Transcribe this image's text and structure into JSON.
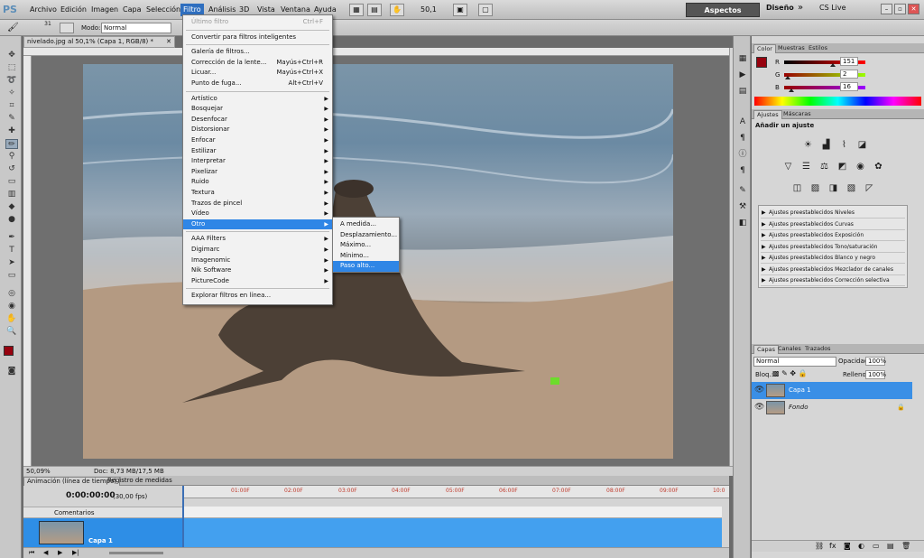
{
  "menubar": {
    "logo": "PS",
    "items": [
      "Archivo",
      "Edición",
      "Imagen",
      "Capa",
      "Selección",
      "Filtro",
      "Análisis",
      "3D",
      "Vista",
      "Ventana",
      "Ayuda"
    ],
    "zoom": "50,1",
    "workspace": "Aspectos esenciales",
    "design": "Diseño",
    "more": "»",
    "cslive": "CS Live"
  },
  "options": {
    "mode_label": "Modo:",
    "mode_value": "Normal",
    "brush_size": "31"
  },
  "document": {
    "tab": "nivelado.jpg al 50,1% (Capa 1, RGB/8) *",
    "zoom": "50,09%",
    "doc_info": "Doc: 8,73 MB/17,5 MB"
  },
  "filter_menu": {
    "items": [
      {
        "label": "Último filtro",
        "shortcut": "Ctrl+F",
        "disabled": true
      },
      {
        "sep": true
      },
      {
        "label": "Convertir para filtros inteligentes"
      },
      {
        "sep": true
      },
      {
        "label": "Galería de filtros..."
      },
      {
        "label": "Corrección de la lente...",
        "shortcut": "Mayús+Ctrl+R"
      },
      {
        "label": "Licuar...",
        "shortcut": "Mayús+Ctrl+X"
      },
      {
        "label": "Punto de fuga...",
        "shortcut": "Alt+Ctrl+V"
      },
      {
        "sep": true
      },
      {
        "label": "Artístico",
        "sub": true
      },
      {
        "label": "Bosquejar",
        "sub": true
      },
      {
        "label": "Desenfocar",
        "sub": true
      },
      {
        "label": "Distorsionar",
        "sub": true
      },
      {
        "label": "Enfocar",
        "sub": true
      },
      {
        "label": "Estilizar",
        "sub": true
      },
      {
        "label": "Interpretar",
        "sub": true
      },
      {
        "label": "Pixelizar",
        "sub": true
      },
      {
        "label": "Ruido",
        "sub": true
      },
      {
        "label": "Textura",
        "sub": true
      },
      {
        "label": "Trazos de pincel",
        "sub": true
      },
      {
        "label": "Vídeo",
        "sub": true
      },
      {
        "label": "Otro",
        "sub": true,
        "highlight": true
      },
      {
        "sep": true
      },
      {
        "label": "AAA Filters",
        "sub": true
      },
      {
        "label": "Digimarc",
        "sub": true
      },
      {
        "label": "Imagenomic",
        "sub": true
      },
      {
        "label": "Nik Software",
        "sub": true
      },
      {
        "label": "PictureCode",
        "sub": true
      },
      {
        "sep": true
      },
      {
        "label": "Explorar filtros en línea..."
      }
    ]
  },
  "sub_menu": {
    "items": [
      "A medida...",
      "Desplazamiento...",
      "Máximo...",
      "Mínimo...",
      "Paso alto..."
    ],
    "highlight_index": 4
  },
  "color_panel": {
    "tabs": [
      "Color",
      "Muestras",
      "Estilos"
    ],
    "r": {
      "label": "R",
      "value": "151",
      "fraction": 0.59
    },
    "g": {
      "label": "G",
      "value": "2",
      "fraction": 0.01
    },
    "b": {
      "label": "B",
      "value": "16",
      "fraction": 0.06
    },
    "fg_color": "#97020f"
  },
  "adjust_panel": {
    "tabs": [
      "Ajustes",
      "Máscaras"
    ],
    "title": "Añadir un ajuste",
    "presets": [
      "Ajustes preestablecidos Niveles",
      "Ajustes preestablecidos Curvas",
      "Ajustes preestablecidos Exposición",
      "Ajustes preestablecidos Tono/saturación",
      "Ajustes preestablecidos Blanco y negro",
      "Ajustes preestablecidos Mezclador de canales",
      "Ajustes preestablecidos Corrección selectiva"
    ]
  },
  "layers_panel": {
    "tabs": [
      "Capas",
      "Canales",
      "Trazados"
    ],
    "blend": "Normal",
    "opacity_label": "Opacidad:",
    "opacity": "100%",
    "lock_label": "Bloq.:",
    "fill_label": "Relleno:",
    "fill": "100%",
    "layers": [
      {
        "name": "Capa 1",
        "selected": true
      },
      {
        "name": "Fondo",
        "selected": false
      }
    ]
  },
  "timeline": {
    "tabs": [
      "Animación (línea de tiempo)",
      "Registro de medidas"
    ],
    "time": "0:00:00:00",
    "fps": "(30,00 fps)",
    "ticks": [
      "01:00F",
      "02:00F",
      "03:00F",
      "04:00F",
      "05:00F",
      "06:00F",
      "07:00F",
      "08:00F",
      "09:00F",
      "10:0"
    ],
    "comments": "Comentarios",
    "layer": "Capa 1"
  }
}
